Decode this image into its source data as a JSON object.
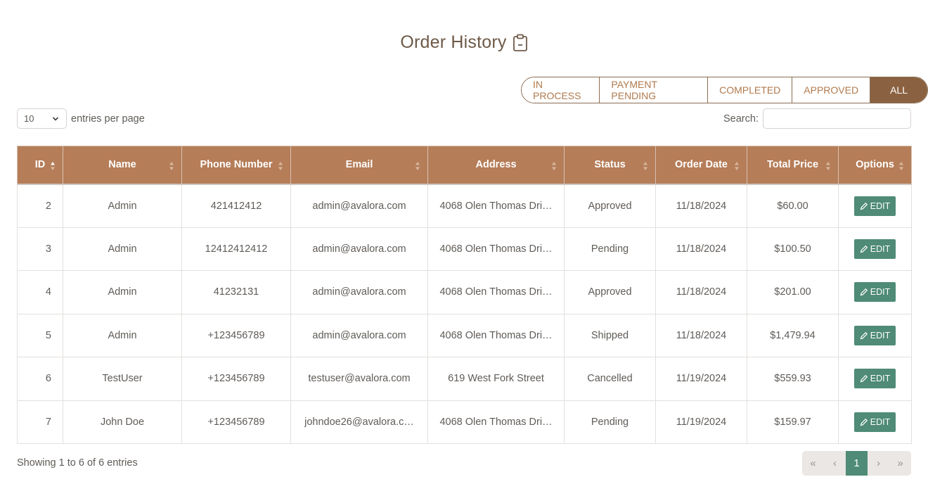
{
  "header": {
    "title": "Order History",
    "icon": "clipboard-icon"
  },
  "filters": [
    {
      "label": "IN PROCESS",
      "active": false
    },
    {
      "label": "PAYMENT PENDING",
      "active": false
    },
    {
      "label": "COMPLETED",
      "active": false
    },
    {
      "label": "APPROVED",
      "active": false
    },
    {
      "label": "ALL",
      "active": true
    }
  ],
  "entries": {
    "value": "10",
    "label": "entries per page"
  },
  "search": {
    "label": "Search:",
    "value": "",
    "placeholder": ""
  },
  "table": {
    "columns": [
      "ID",
      "Name",
      "Phone Number",
      "Email",
      "Address",
      "Status",
      "Order Date",
      "Total Price",
      "Options"
    ],
    "rows": [
      {
        "id": "2",
        "name": "Admin",
        "phone": "421412412",
        "email": "admin@avalora.com",
        "address": "4068 Olen Thomas Dri…",
        "status": "Approved",
        "date": "11/18/2024",
        "total": "$60.00",
        "action": "EDIT"
      },
      {
        "id": "3",
        "name": "Admin",
        "phone": "12412412412",
        "email": "admin@avalora.com",
        "address": "4068 Olen Thomas Dri…",
        "status": "Pending",
        "date": "11/18/2024",
        "total": "$100.50",
        "action": "EDIT"
      },
      {
        "id": "4",
        "name": "Admin",
        "phone": "41232131",
        "email": "admin@avalora.com",
        "address": "4068 Olen Thomas Dri…",
        "status": "Approved",
        "date": "11/18/2024",
        "total": "$201.00",
        "action": "EDIT"
      },
      {
        "id": "5",
        "name": "Admin",
        "phone": "+123456789",
        "email": "admin@avalora.com",
        "address": "4068 Olen Thomas Dri…",
        "status": "Shipped",
        "date": "11/18/2024",
        "total": "$1,479.94",
        "action": "EDIT"
      },
      {
        "id": "6",
        "name": "TestUser",
        "phone": "+123456789",
        "email": "testuser@avalora.com",
        "address": "619 West Fork Street",
        "status": "Cancelled",
        "date": "11/19/2024",
        "total": "$559.93",
        "action": "EDIT"
      },
      {
        "id": "7",
        "name": "John Doe",
        "phone": "+123456789",
        "email": "johndoe26@avalora.c…",
        "address": "4068 Olen Thomas Dri…",
        "status": "Pending",
        "date": "11/19/2024",
        "total": "$159.97",
        "action": "EDIT"
      }
    ]
  },
  "footer": {
    "showing": "Showing 1 to 6 of 6 entries"
  },
  "pagination": {
    "first": "«",
    "prev": "‹",
    "current": "1",
    "next": "›",
    "last": "»"
  },
  "colors": {
    "header_bg": "#b57d58",
    "accent_brown": "#8b6241",
    "edit_green": "#4f8b76"
  }
}
